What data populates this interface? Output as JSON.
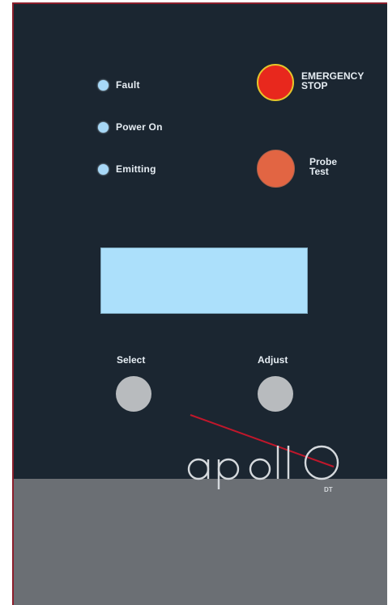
{
  "indicators": [
    {
      "label": "Fault",
      "color": "#a7d8f7"
    },
    {
      "label": "Power On",
      "color": "#a7d8f7"
    },
    {
      "label": "Emitting",
      "color": "#a7d8f7"
    }
  ],
  "emergency_stop": {
    "label": "EMERGENCY\nSTOP",
    "color": "#e8281d"
  },
  "probe_test": {
    "label": "Probe\nTest",
    "color": "#e26543"
  },
  "display": {
    "text": ""
  },
  "controls": {
    "select_label": "Select",
    "adjust_label": "Adjust"
  },
  "logo": {
    "brand": "apollo",
    "model": "DT"
  },
  "colors": {
    "panel": "#1b2631",
    "bottom_plate": "#6b6f74",
    "border": "#8b1e2b",
    "pointer_line": "#c0172b"
  }
}
